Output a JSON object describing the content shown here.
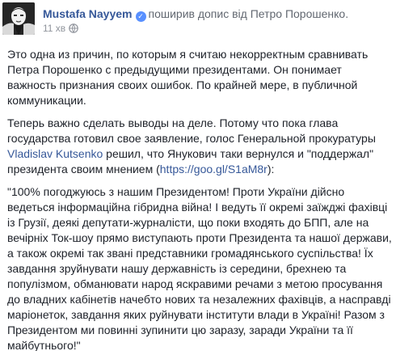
{
  "post": {
    "author": "Mustafa Nayyem",
    "shared_text": "поширив допис від Петро Порошенко.",
    "timestamp": "11 хв",
    "body": {
      "p1": "Это одна из причин, по которым я считаю некорректным сравнивать Петра Порошенко с предыдущими президентами. Он понимает важность признания своих ошибок. По крайней мере, в публичной коммуникации.",
      "p2_before": "Теперь важно сделать выводы на деле. Потому что пока глава государства готовил свое заявление, голос Генеральной прокуратуры ",
      "p2_mention": "Vladislav Kutsenko",
      "p2_middle": " решил, что Янукович таки вернулся и \"поддержал\" президента своим мнением (",
      "p2_link": "https://goo.gl/S1aM8r",
      "p2_after": "):",
      "p3": "\"100% погоджуюсь з нашим Президентом! Проти України дійсно ведеться інформаційна гібридна війна! І ведуть її окремі заїжджі фахівці із Грузії, деякі депутати-журналісти, що поки входять до БПП, але на вечірніх Ток-шоу прямо виступають проти Президента та нашої держави, а також окремі так звані представники громадянського суспільства! Їх завдання зруйнувати нашу державність із середини, брехнею та популізмом, обманювати народ яскравими речами з метою просування до владних кабінетів начебто нових та незалежних фахівців, а насправді маріонеток, завдання яких руйнувати інститути влади в Україні! Разом з Президентом ми повинні зупинити цю заразу, заради України та її майбутнього!\""
    }
  },
  "colors": {
    "link": "#365899",
    "verified_badge": "#5890ff",
    "meta": "#90949c",
    "text": "#1d2129"
  },
  "icons": {
    "verified": "verified-check-icon",
    "audience": "globe-icon"
  }
}
